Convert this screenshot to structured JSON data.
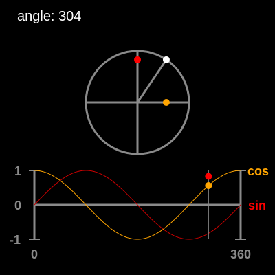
{
  "readout": {
    "label": "angle:",
    "angle": 304
  },
  "axis": {
    "y_top": "1",
    "y_mid": "0",
    "y_bottom": "-1",
    "x_start": "0",
    "x_end": "360"
  },
  "legend": {
    "cos": "cos",
    "sin": "sin"
  },
  "colors": {
    "background": "#000000",
    "structure": "#8a8a8a",
    "cos": "#ffa500",
    "sin": "#ff0000",
    "current_point": "#ffffff",
    "sin_curve": "#cc0000",
    "cos_curve": "#ffa500"
  }
}
